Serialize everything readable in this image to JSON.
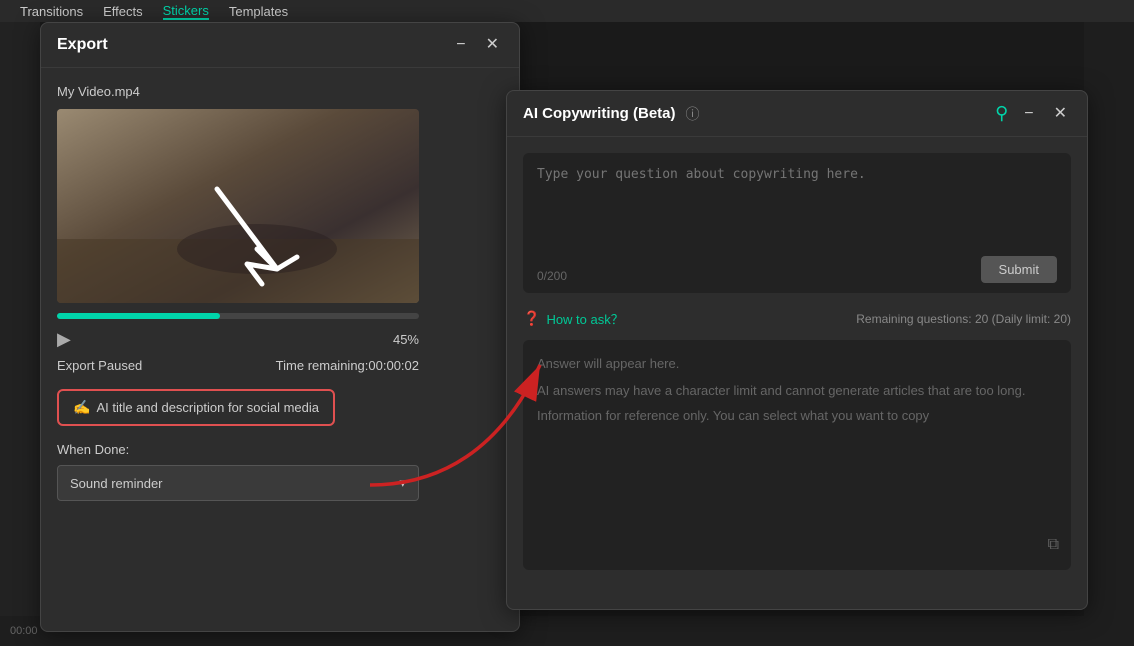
{
  "nav": {
    "items": [
      "Transitions",
      "Effects",
      "Stickers",
      "Templates"
    ]
  },
  "export_dialog": {
    "title": "Export",
    "minimize_label": "−",
    "close_label": "✕",
    "filename": "My Video.mp4",
    "progress_percent": "45%",
    "progress_value": 45,
    "status": "Export Paused",
    "time_remaining_label": "Time remaining:",
    "time_remaining_value": "00:00:02",
    "ai_button_label": "AI title and description for social media",
    "when_done_label": "When Done:",
    "sound_reminder": "Sound reminder",
    "dropdown_arrow": "▾"
  },
  "ai_panel": {
    "title": "AI Copywriting (Beta)",
    "info_icon": "ⓘ",
    "pin_icon": "⚲",
    "minimize_label": "−",
    "close_label": "✕",
    "textarea_placeholder": "Type your question about copywriting here.",
    "char_count": "0/200",
    "submit_label": "Submit",
    "how_to_ask_label": "How to ask？",
    "remaining_label": "Remaining questions: 20 (Daily limit: 20)",
    "answer_placeholder_line1": "Answer will appear here.",
    "answer_placeholder_line2": "AI answers may have a character limit and cannot generate articles that are too long.",
    "answer_placeholder_line3": "Information for reference only. You can select what you want to copy"
  }
}
